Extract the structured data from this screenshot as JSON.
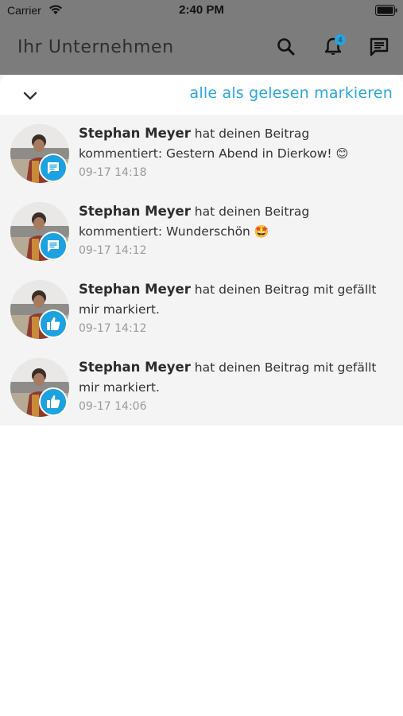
{
  "status_bar": {
    "carrier": "Carrier",
    "time": "2:40 PM"
  },
  "header": {
    "title": "Ihr Unternehmen",
    "notification_badge_count": "4",
    "icons": [
      "search-icon",
      "bell-icon",
      "message-icon"
    ]
  },
  "panel": {
    "mark_all_read_label": "alle als gelesen markieren",
    "collapse_icon": "chevron-down-icon"
  },
  "notifications": [
    {
      "author": "Stephan Meyer",
      "text": " hat deinen Beitrag kommentiert: Gestern Abend in Dierkow! ",
      "emoji": "😊",
      "time": "09-17 14:18",
      "type_icon": "comment-icon"
    },
    {
      "author": "Stephan Meyer",
      "text": " hat deinen Beitrag kommentiert: Wunderschön ",
      "emoji": "🤩",
      "time": "09-17 14:12",
      "type_icon": "comment-icon"
    },
    {
      "author": "Stephan Meyer",
      "text": " hat deinen Beitrag mit gefällt mir markiert.",
      "emoji": "",
      "time": "09-17 14:12",
      "type_icon": "thumbs-up-icon"
    },
    {
      "author": "Stephan Meyer",
      "text": " hat deinen Beitrag mit gefällt mir markiert.",
      "emoji": "",
      "time": "09-17 14:06",
      "type_icon": "thumbs-up-icon"
    }
  ],
  "colors": {
    "accent": "#29a7dc",
    "badge_blue": "#1da1df",
    "header_overlay": "#7c7c7c",
    "list_background": "#f4f4f4"
  }
}
